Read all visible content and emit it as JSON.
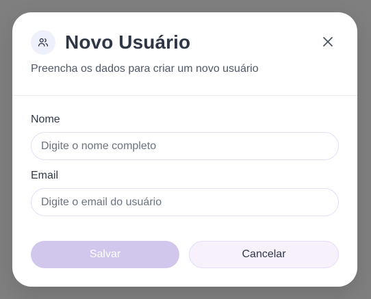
{
  "modal": {
    "title": "Novo Usuário",
    "subtitle": "Preencha os dados para criar um novo usuário",
    "header_icon": "users-icon",
    "close_icon": "close-icon"
  },
  "form": {
    "name": {
      "label": "Nome",
      "placeholder": "Digite o nome completo",
      "value": ""
    },
    "email": {
      "label": "Email",
      "placeholder": "Digite o email do usuário",
      "value": ""
    }
  },
  "actions": {
    "save_label": "Salvar",
    "cancel_label": "Cancelar"
  },
  "colors": {
    "backdrop": "#7f7f7f",
    "accent_disabled": "#d1c6ec",
    "cancel_bg": "#f6f1fa",
    "text": "#2f3747"
  }
}
